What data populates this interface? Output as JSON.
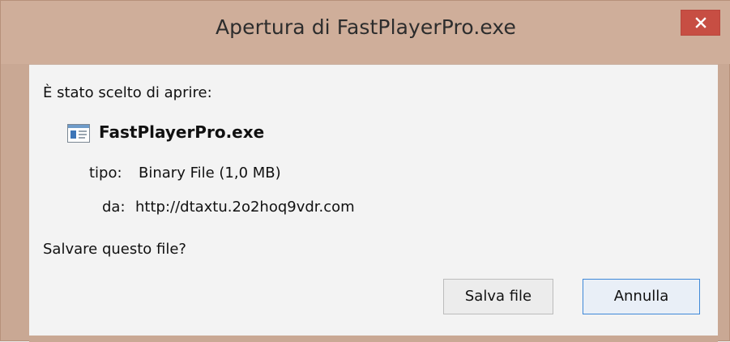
{
  "window": {
    "title": "Apertura di FastPlayerPro.exe",
    "close_icon": "close-icon"
  },
  "dialog": {
    "intro_text": "È stato scelto di aprire:",
    "file": {
      "icon": "application-window-icon",
      "name": "FastPlayerPro.exe",
      "type_label": "tipo:",
      "type_value": "Binary File (1,0 MB)",
      "from_label": "da:",
      "from_value": "http://dtaxtu.2o2hoq9vdr.com"
    },
    "question": "Salvare questo file?",
    "buttons": {
      "save_label": "Salva file",
      "cancel_label": "Annulla"
    }
  },
  "colors": {
    "title_bar": "#cfae9a",
    "window_border": "#c9a894",
    "close_button": "#c74e43",
    "dialog_background": "#f3f3f3",
    "default_button_border": "#3f88d8"
  }
}
